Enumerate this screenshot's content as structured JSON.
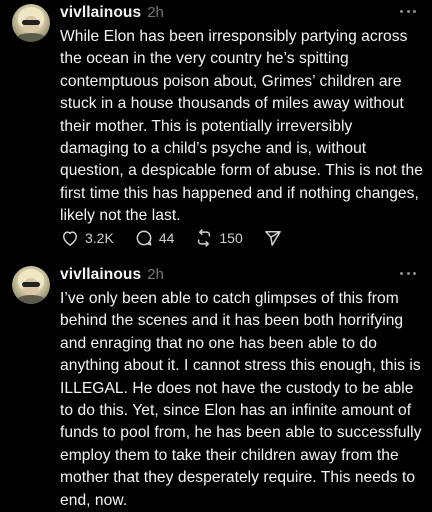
{
  "posts": [
    {
      "username": "vivllainous",
      "time": "2h",
      "text": "While Elon has been irresponsibly partying across the ocean in the very country he’s spitting contemptuous poison about, Grimes’ children are stuck in a house thousands of miles away without their mother. This is potentially irreversibly damaging to a child’s psyche and is, without question, a despicable form of abuse. This is not the first time this has happened and if nothing changes, likely not the last.",
      "likes": "3.2K",
      "replies": "44",
      "reposts": "150"
    },
    {
      "username": "vivllainous",
      "time": "2h",
      "text": "I’ve only been able to catch glimpses of this from behind the scenes and it has been both horrifying and enraging that no one has been able to do anything about it. I cannot stress this enough, this is ILLEGAL. He does not have the custody to be able to do this. Yet, since Elon has an infinite amount of funds to pool from, he has been able to successfully employ them to take their children away from the mother that they desperately require. This needs to end, now."
    }
  ],
  "icons": {
    "like": "heart-icon",
    "reply": "comment-icon",
    "repost": "repost-icon",
    "share": "send-icon",
    "more": "more-icon"
  },
  "colors": {
    "background": "#000000",
    "text": "#f3f5f7",
    "muted": "#777777"
  }
}
